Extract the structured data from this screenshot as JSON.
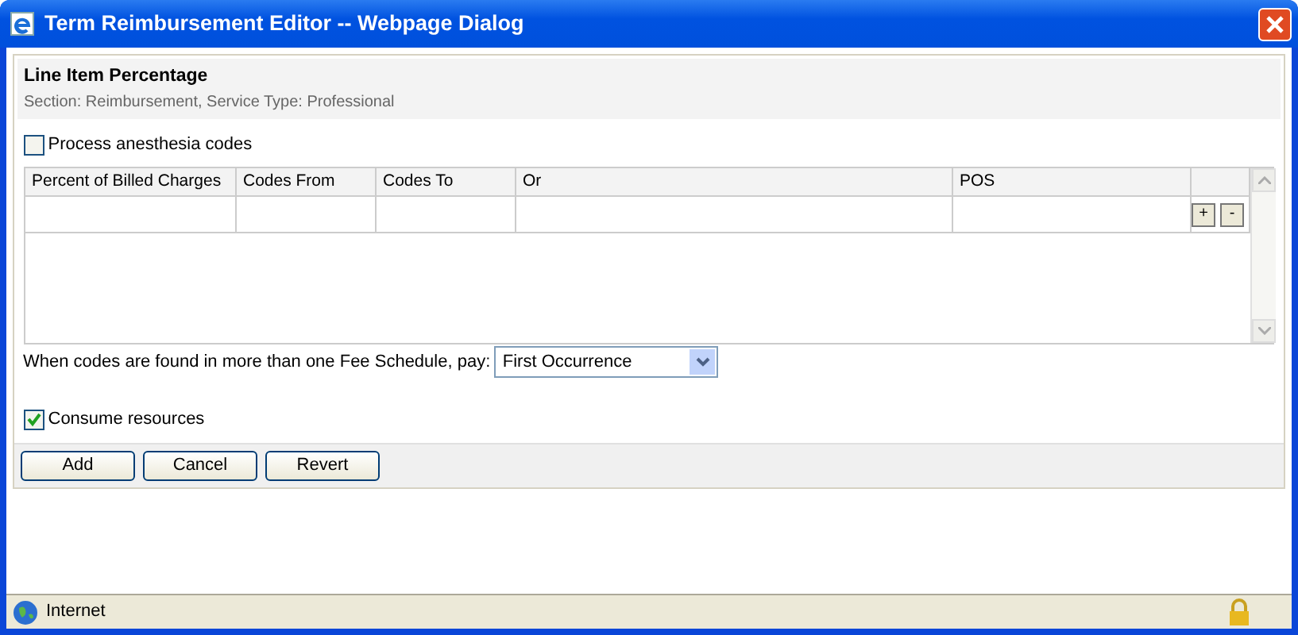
{
  "window": {
    "title": "Term Reimbursement Editor -- Webpage Dialog"
  },
  "header": {
    "title": "Line Item Percentage",
    "subtitle": "Section: Reimbursement, Service Type: Professional"
  },
  "options": [
    {
      "label": "Process anesthesia codes",
      "checked": false
    }
  ],
  "table": {
    "columns": [
      "Percent of Billed Charges",
      "Codes From",
      "Codes To",
      "Or",
      "POS"
    ],
    "row_buttons": [
      "+",
      "-"
    ]
  },
  "fee_schedule": {
    "label": "When codes are found in more than one Fee Schedule, pay:",
    "value": "First Occurrence"
  },
  "consume": {
    "label": "Consume resources",
    "checked": true
  },
  "buttons": [
    "Add",
    "Cancel",
    "Revert"
  ],
  "status_bar": {
    "zone": "Internet"
  }
}
